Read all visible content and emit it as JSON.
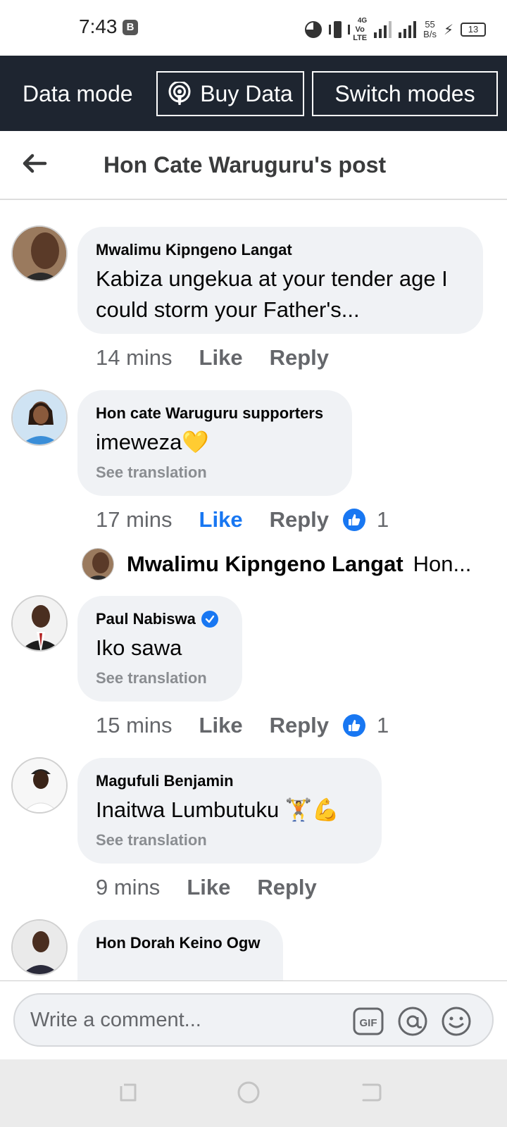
{
  "status_bar": {
    "time": "7:43",
    "badge": "B",
    "volte": "Vo\nLTE",
    "network": "4G",
    "speed_value": "55",
    "speed_unit": "B/s",
    "battery": "13"
  },
  "data_mode": {
    "label": "Data mode",
    "buy_label": "Buy Data",
    "switch_label": "Switch modes"
  },
  "header": {
    "title": "Hon Cate Waruguru's post"
  },
  "comments": [
    {
      "name": "Mwalimu Kipngeno Langat",
      "text": "Kabiza ungekua at your tender age I could storm your Father's...",
      "time": "14 mins",
      "like": "Like",
      "reply": "Reply"
    },
    {
      "name": "Hon cate Waruguru supporters",
      "text": "imeweza💛",
      "translation": "See translation",
      "time": "17 mins",
      "like": "Like",
      "reply": "Reply",
      "reactions": "1"
    },
    {
      "name": "Paul Nabiswa",
      "text": "Iko sawa",
      "translation": "See translation",
      "time": "15 mins",
      "like": "Like",
      "reply": "Reply",
      "reactions": "1"
    },
    {
      "name": "Magufuli Benjamin",
      "text": "Inaitwa Lumbutuku 🏋️💪",
      "translation": "See translation",
      "time": "9 mins",
      "like": "Like",
      "reply": "Reply"
    },
    {
      "name": "Hon Dorah Keino Ogw"
    }
  ],
  "reply_preview": {
    "name": "Mwalimu Kipngeno Langat",
    "snippet": "Hon..."
  },
  "composer": {
    "placeholder": "Write a comment...",
    "gif_label": "GIF"
  },
  "colors": {
    "accent": "#1877f2",
    "banner_bg": "#1e2530",
    "bubble_bg": "#f0f2f5"
  }
}
